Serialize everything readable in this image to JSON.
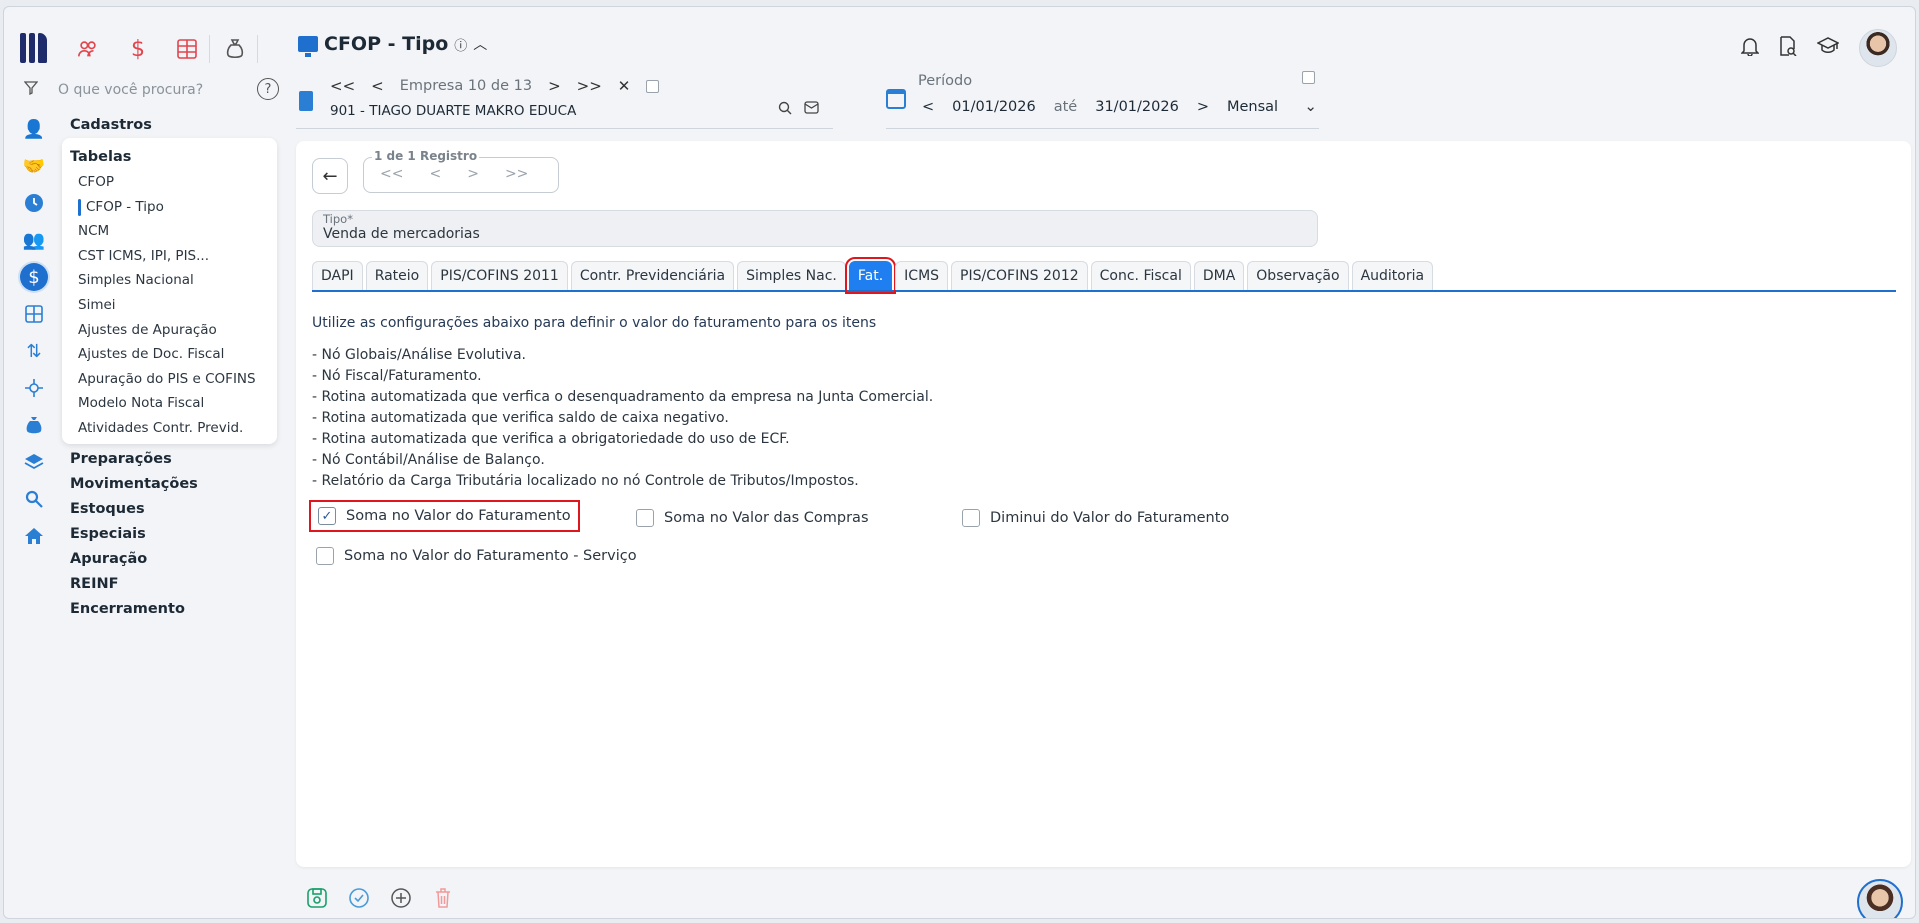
{
  "app": {
    "quick_icons": [
      "users-icon",
      "dollar-icon",
      "grid-icon",
      "money-bag-icon"
    ],
    "search_placeholder": "O que você procura?",
    "help_label": "?"
  },
  "header": {
    "title": "CFOP - Tipo",
    "info_glyph": "ⓘ",
    "collapse_glyph": "︿"
  },
  "company": {
    "first": "<<",
    "prev": "<",
    "label": "Empresa 10 de 13",
    "next": ">",
    "last": ">>",
    "close": "✕",
    "value": "901 - TIAGO DUARTE MAKRO EDUCA"
  },
  "periodo": {
    "label": "Período",
    "prev": "<",
    "start": "01/01/2026",
    "until": "até",
    "end": "31/01/2026",
    "next": ">",
    "mode": "Mensal"
  },
  "sidebar": {
    "top_section": "Cadastros",
    "submenu_title": "Tabelas",
    "submenu_items": [
      "CFOP",
      "CFOP - Tipo",
      "NCM",
      "CST ICMS, IPI, PIS...",
      "Simples Nacional",
      "Simei",
      "Ajustes de Apuração",
      "Ajustes de Doc. Fiscal",
      "Apuração do PIS e COFINS",
      "Modelo Nota Fiscal",
      "Atividades Contr. Previd."
    ],
    "sections": [
      "Preparações",
      "Movimentações",
      "Estoques",
      "Especiais",
      "Apuração",
      "REINF",
      "Encerramento"
    ]
  },
  "record": {
    "back": "←",
    "counter": "1 de 1 Registro",
    "first": "<<",
    "prev": "<",
    "next": ">",
    "last": ">>"
  },
  "tipo": {
    "label": "Tipo*",
    "value": "Venda de mercadorias"
  },
  "tabs": [
    "DAPI",
    "Rateio",
    "PIS/COFINS 2011",
    "Contr. Previdenciária",
    "Simples Nac.",
    "Fat.",
    "ICMS",
    "PIS/COFINS 2012",
    "Conc. Fiscal",
    "DMA",
    "Observação",
    "Auditoria"
  ],
  "active_tab": "Fat.",
  "content": {
    "intro": "Utilize as configurações abaixo para definir o valor do faturamento para os itens",
    "lines": [
      "- Nó Globais/Análise Evolutiva.",
      "- Nó Fiscal/Faturamento.",
      "- Rotina automatizada que verfica o desenquadramento da empresa na Junta Comercial.",
      "- Rotina automatizada que verifica saldo de caixa negativo.",
      "- Rotina automatizada que verifica a obrigatoriedade do uso de ECF.",
      "- Nó Contábil/Análise de Balanço.",
      "- Relatório da Carga Tributária localizado no nó Controle de Tributos/Impostos."
    ],
    "options": [
      {
        "label": "Soma no Valor do Faturamento",
        "checked": true
      },
      {
        "label": "Soma no Valor das Compras",
        "checked": false
      },
      {
        "label": "Diminui do Valor do Faturamento",
        "checked": false
      },
      {
        "label": "Soma no Valor do Faturamento - Serviço",
        "checked": false
      }
    ]
  },
  "colors": {
    "accent": "#1f7ff0",
    "highlight": "#e0161e",
    "brand_dark": "#1f2c6b"
  }
}
